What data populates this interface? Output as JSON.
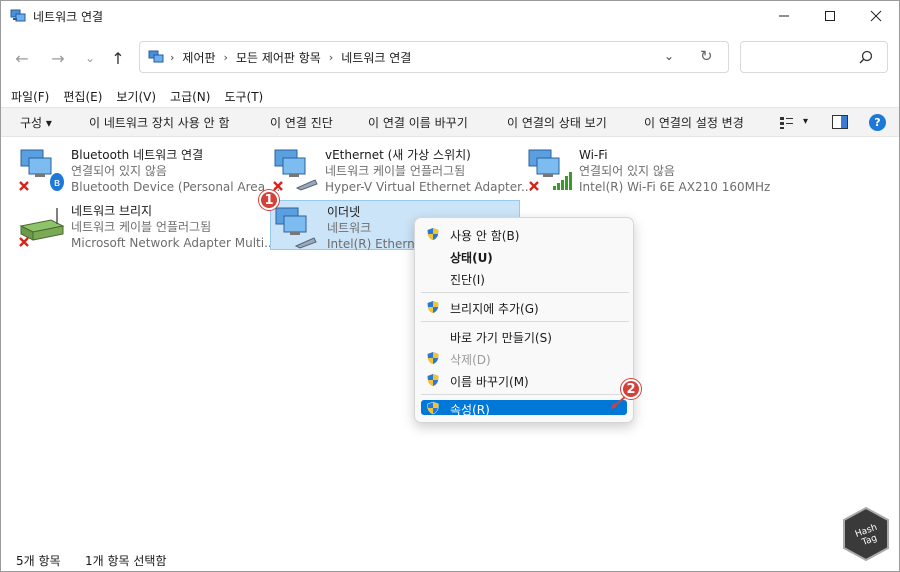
{
  "window": {
    "title": "네트워크 연결",
    "controls": {
      "minimize": "–",
      "maximize": "☐",
      "close": "✕"
    }
  },
  "nav": {
    "back": "←",
    "forward": "→",
    "recent": "⌄",
    "up": "↑"
  },
  "address": {
    "breadcrumbs": [
      "제어판",
      "모든 제어판 항목",
      "네트워크 연결"
    ],
    "separator": "›",
    "dropdown": "⌄",
    "refresh": "↻",
    "search_placeholder": ""
  },
  "menubar": [
    "파일(F)",
    "편집(E)",
    "보기(V)",
    "고급(N)",
    "도구(T)"
  ],
  "commandbar": {
    "organize": "구성 ▾",
    "commands": [
      "이 네트워크 장치 사용 안 함",
      "이 연결 진단",
      "이 연결 이름 바꾸기",
      "이 연결의 상태 보기",
      "이 연결의 설정 변경"
    ],
    "view_dropdown": "▾",
    "help": "?"
  },
  "connections": [
    {
      "name": "Bluetooth 네트워크 연결",
      "status": "연결되어 있지 않음",
      "device": "Bluetooth Device (Personal Area ...",
      "icon": "bluetooth-network-icon",
      "disconnected": true
    },
    {
      "name": "vEthernet (새 가상 스위치)",
      "status": "네트워크 케이블 언플러그됨",
      "device": "Hyper-V Virtual Ethernet Adapter...",
      "icon": "ethernet-network-icon",
      "disconnected": true
    },
    {
      "name": "Wi-Fi",
      "status": "연결되어 있지 않음",
      "device": "Intel(R) Wi-Fi 6E AX210 160MHz",
      "icon": "wifi-network-icon",
      "disconnected": true
    },
    {
      "name": "네트워크 브리지",
      "status": "네트워크 케이블 언플러그됨",
      "device": "Microsoft Network Adapter Multi...",
      "icon": "bridge-network-icon",
      "disconnected": true
    },
    {
      "name": "이더넷",
      "status": "네트워크",
      "device": "Intel(R) Ethernet",
      "icon": "ethernet-network-icon",
      "disconnected": false,
      "selected": true
    }
  ],
  "context_menu": [
    {
      "label": "사용 안 함(B)",
      "shield": true
    },
    {
      "label": "상태(U)",
      "bold": true
    },
    {
      "label": "진단(I)"
    },
    {
      "label": "브리지에 추가(G)",
      "shield": true
    },
    {
      "label": "바로 가기 만들기(S)"
    },
    {
      "label": "삭제(D)",
      "shield": true,
      "disabled": true
    },
    {
      "label": "이름 바꾸기(M)",
      "shield": true
    },
    {
      "label": "속성(R)",
      "shield": true,
      "highlighted": true
    }
  ],
  "annotations": {
    "step1": "1",
    "step2": "2"
  },
  "status": {
    "item_count": "5개 항목",
    "selected_count": "1개 항목 선택함"
  },
  "watermark": {
    "text": "Hash Tag"
  },
  "colors": {
    "accent": "#0078d7",
    "selection": "#cce4f7",
    "badge": "#d4413b"
  }
}
